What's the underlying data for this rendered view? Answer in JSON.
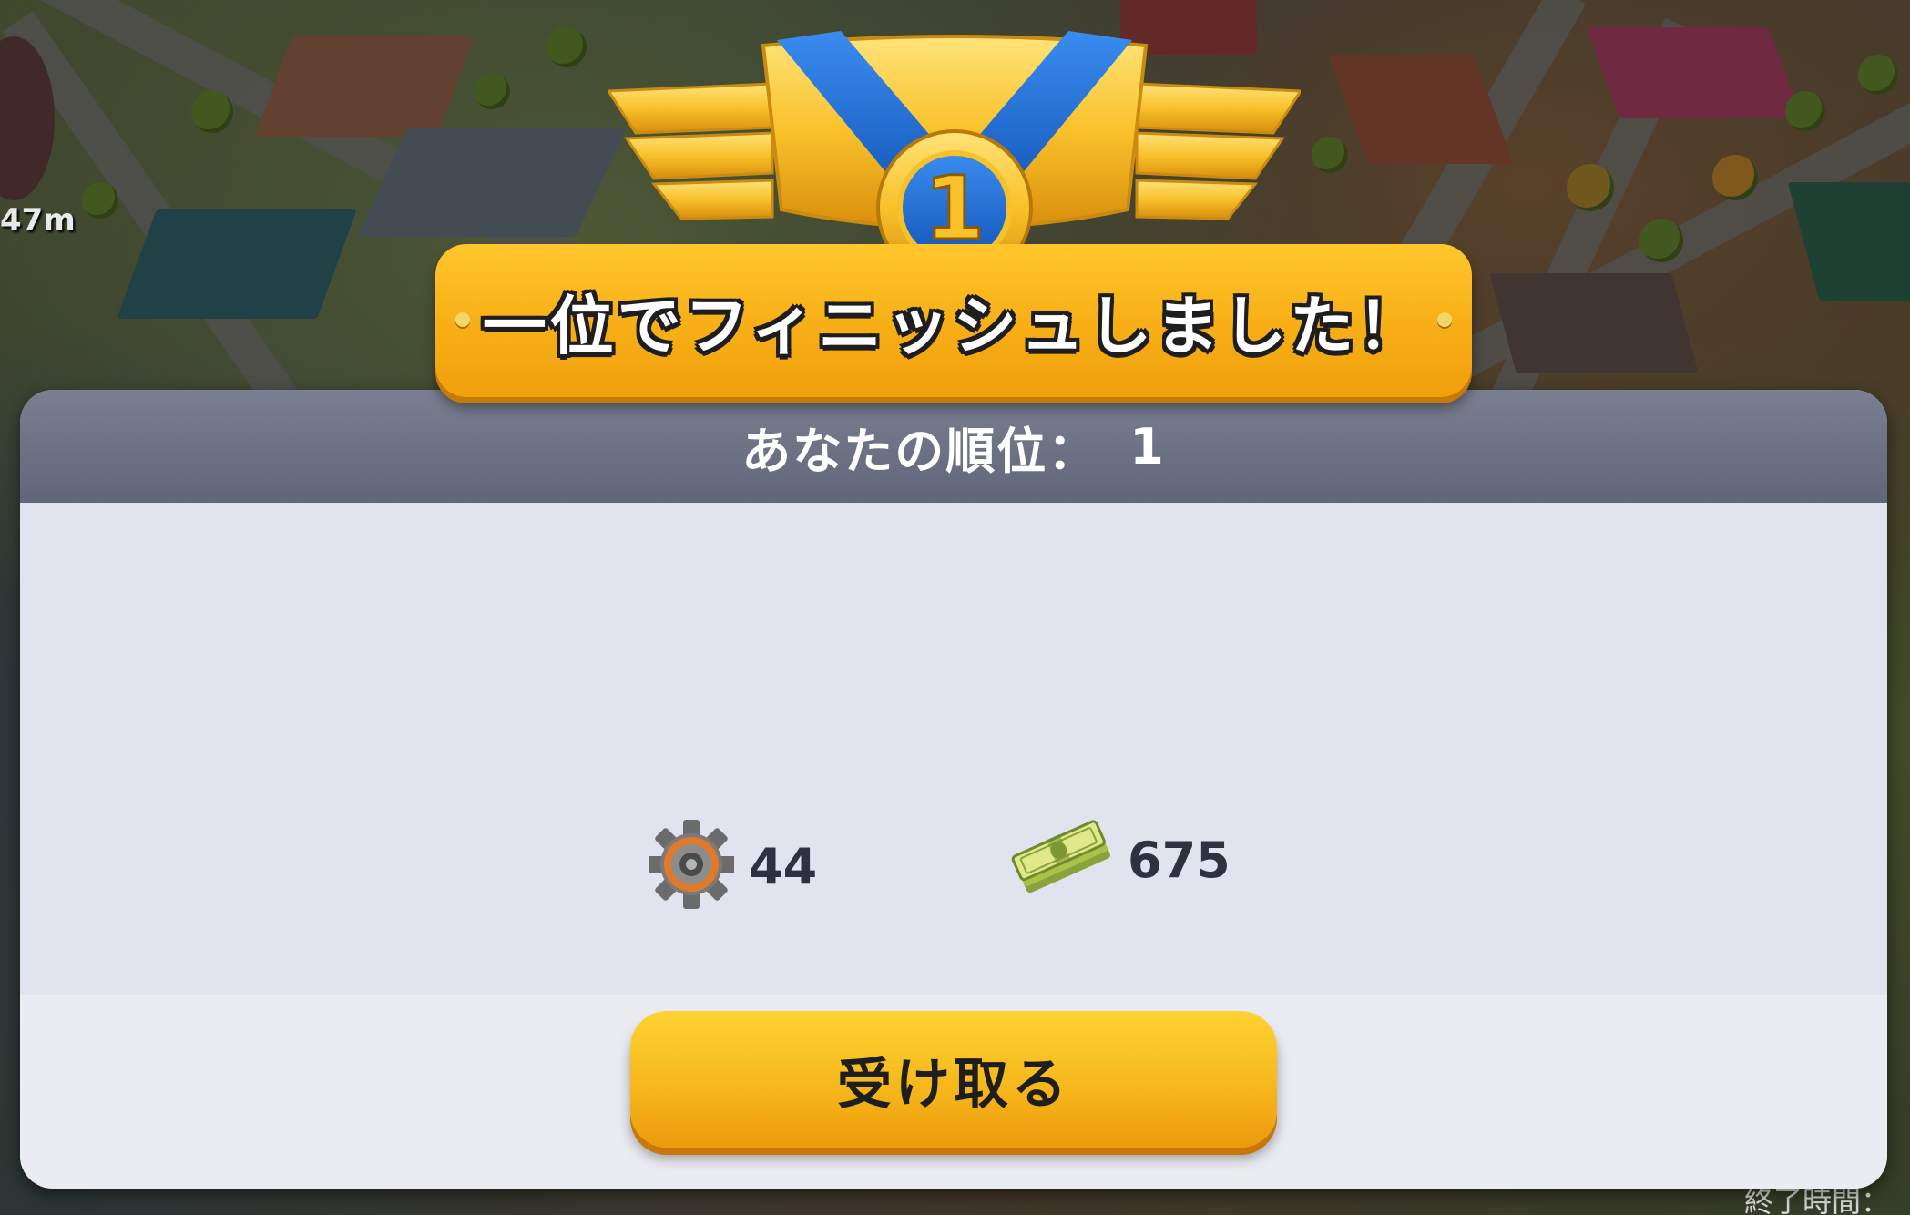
{
  "banner": {
    "title": "一位でフィニッシュしました！"
  },
  "medal": {
    "rank_number": "1",
    "icon": "gold-medal-icon"
  },
  "header": {
    "rank_label": "あなたの順位：",
    "rank_value": "1"
  },
  "rewards": [
    {
      "icon": "gear-icon",
      "amount": "44"
    },
    {
      "icon": "cash-icon",
      "amount": "675"
    }
  ],
  "claim_button": {
    "label": "受け取る"
  },
  "background": {
    "distance_label": "47m",
    "end_time_label": "終了時間："
  },
  "colors": {
    "banner_yellow": "#f8b018",
    "ribbon_blue": "#1f6fd6",
    "header_gray": "#6b7083",
    "panel_bg": "#e1e3ef",
    "button_yellow": "#f6b81c"
  }
}
